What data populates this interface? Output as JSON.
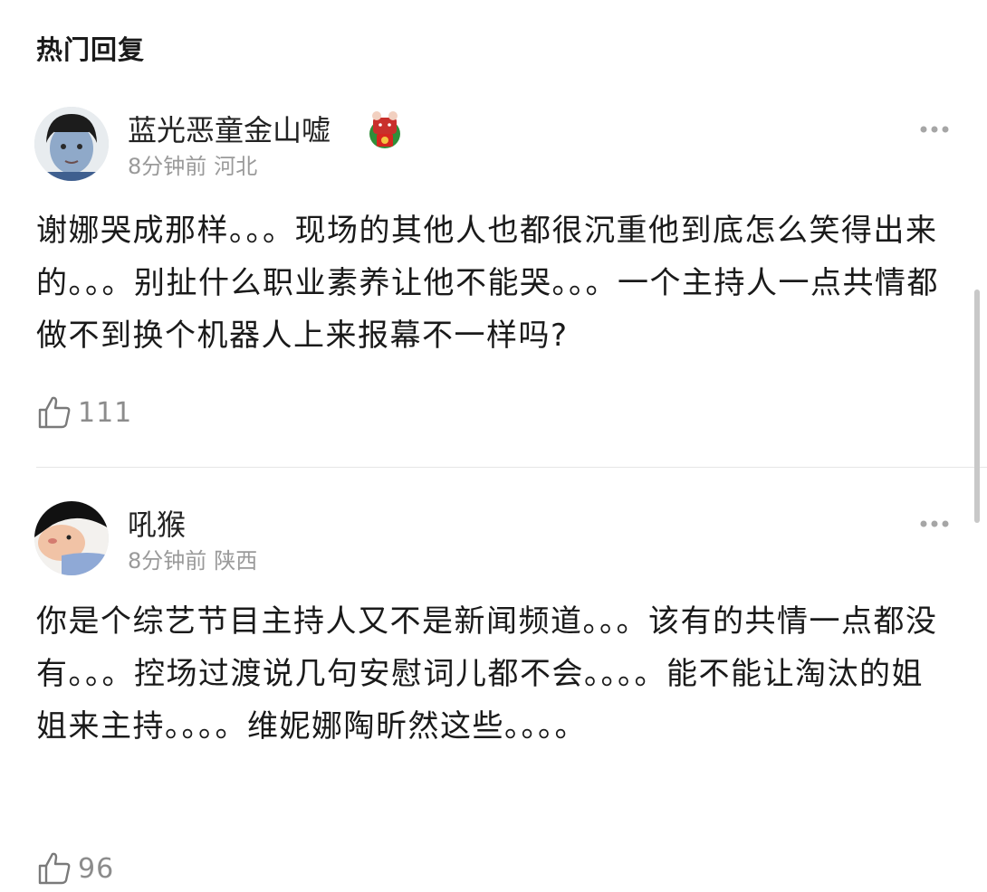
{
  "section_title": "热门回复",
  "comments": [
    {
      "username": "蓝光恶童金山嘘",
      "time": "8分钟前",
      "location": "河北",
      "text": "谢娜哭成那样。。。现场的其他人也都很沉重他到底怎么笑得出来的。。。别扯什么职业素养让他不能哭。。。一个主持人一点共情都做不到换个机器人上来报幕不一样吗?",
      "likes": "111",
      "avatar_icon": "child-avatar",
      "badge_icon": "red-envelope-ox-badge-icon",
      "more_icon": "more-dots-icon"
    },
    {
      "username": "吼猴",
      "time": "8分钟前",
      "location": "陕西",
      "text": "你是个综艺节目主持人又不是新闻频道。。。该有的共情一点都没有。。。控场过渡说几句安慰词儿都不会。。。。能不能让淘汰的姐姐来主持。。。。维妮娜陶昕然这些。。。。",
      "likes": "96",
      "avatar_icon": "cartoon-avatar",
      "more_icon": "more-dots-icon"
    }
  ],
  "colors": {
    "text_primary": "#1a1a1a",
    "text_secondary": "#9a9a9a",
    "divider": "#e6e6e6",
    "badge_red": "#d6261f"
  }
}
